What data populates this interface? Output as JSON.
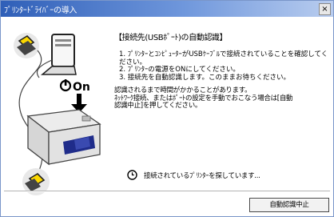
{
  "window": {
    "title": "ﾌﾟﾘﾝﾀｰﾄﾞﾗｲﾊﾞｰの導入",
    "close_glyph": "×"
  },
  "illustration": {
    "power_label": "On",
    "icons": [
      "laptop-icon",
      "printer-icon",
      "usb-plug-icon",
      "power-icon",
      "down-arrow-icon"
    ]
  },
  "content": {
    "heading": "【接続先(USBﾎﾟｰﾄ)の自動認識】",
    "steps": [
      "1. ﾌﾟﾘﾝﾀｰとｺﾝﾋﾟｭｰﾀｰがUSBｹｰﾌﾞﾙで接続されていることを確認してください。",
      "2. ﾌﾟﾘﾝﾀｰの電源をONにしてください。",
      "3. 接続先を自動認識します。このままお待ちください。"
    ],
    "notes": [
      "認識されるまで時間がかかることがあります。",
      "ﾈｯﾄﾜｰｸ接続、またはﾎﾟｰﾄの設定を手動でおこなう場合は[自動",
      "認識中止]を押してください。"
    ],
    "status_text": "接続されているﾌﾟﾘﾝﾀｰを探しています..."
  },
  "buttons": {
    "stop_label": "自動認識中止"
  }
}
